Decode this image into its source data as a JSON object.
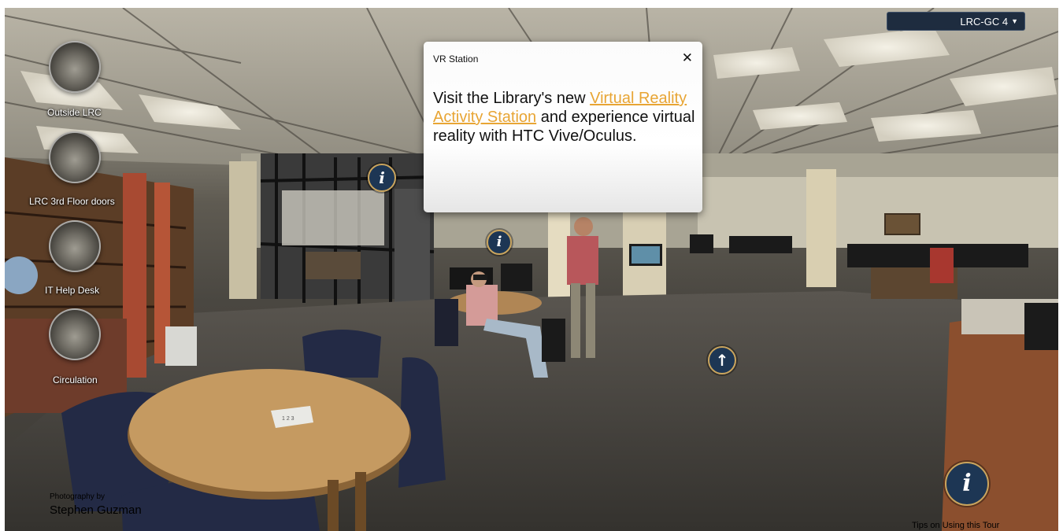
{
  "locations": [
    {
      "label": "Outside LRC"
    },
    {
      "label": "LRC 3rd Floor doors"
    },
    {
      "label": "IT Help Desk"
    },
    {
      "label": "Circulation"
    }
  ],
  "dropdown": {
    "selected": "LRC-GC 4",
    "icon": "caret-down-icon"
  },
  "modal": {
    "title": "VR Station",
    "close_icon": "close-icon",
    "body_before": "Visit the Library's new ",
    "link_text": "Virtual Reality Activity Station",
    "body_after": " and experience virtual reality with HTC Vive/Oculus.",
    "link_color": "#e8a534"
  },
  "hotspots": {
    "info_icon": "info-icon",
    "nav_icon": "arrow-up-icon",
    "info_glyph": "i",
    "nav_glyph": "↑"
  },
  "scene": {
    "table_paper_text": "1 2 3"
  },
  "credit": {
    "line1": "Photography by",
    "line2": "Stephen Guzman"
  },
  "tips": {
    "label": "Tips on Using this Tour"
  },
  "colors": {
    "hotspot_fill": "#1d3654",
    "hotspot_ring": "#caa55e",
    "dropdown_bg": "#1e2c3f"
  }
}
